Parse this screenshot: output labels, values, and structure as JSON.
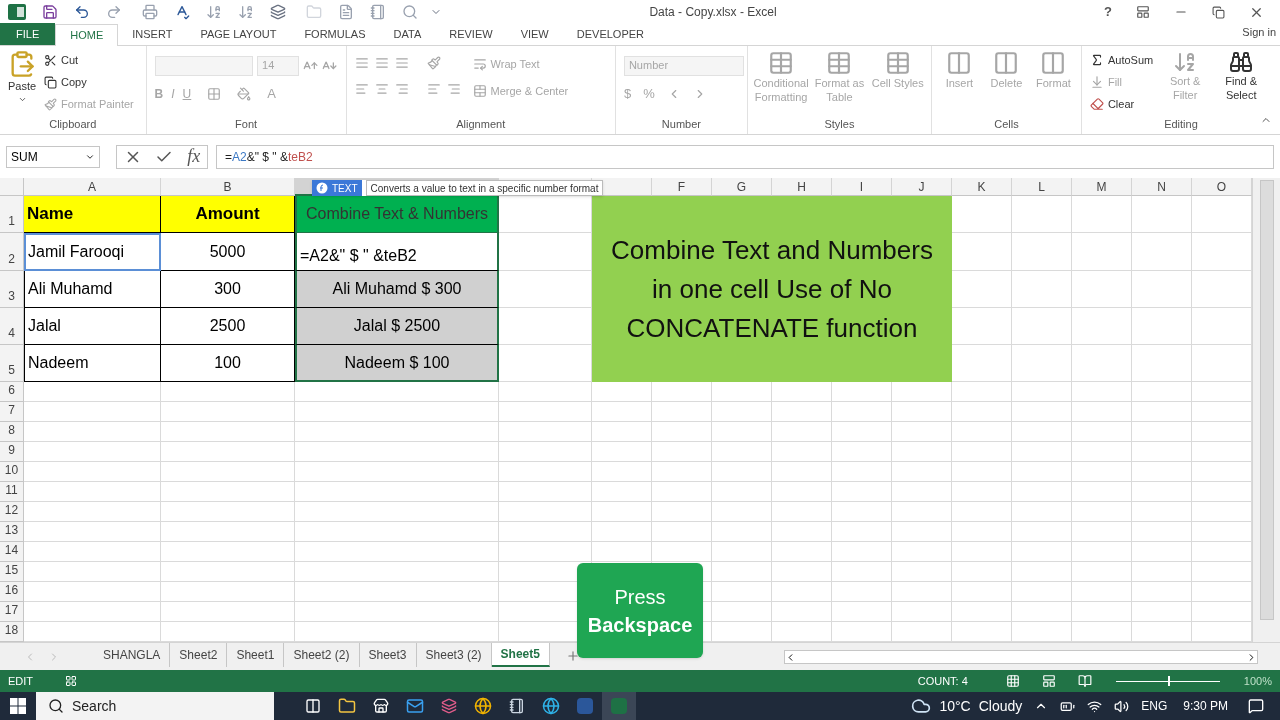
{
  "window": {
    "title": "Data - Copy.xlsx - Excel",
    "help": "?",
    "account": "Sign in"
  },
  "ribbon_tabs": [
    {
      "label": "FILE",
      "kind": "file",
      "selected": false
    },
    {
      "label": "HOME",
      "kind": "tab",
      "selected": true
    },
    {
      "label": "INSERT",
      "kind": "tab",
      "selected": false
    },
    {
      "label": "PAGE LAYOUT",
      "kind": "tab",
      "selected": false
    },
    {
      "label": "FORMULAS",
      "kind": "tab",
      "selected": false
    },
    {
      "label": "DATA",
      "kind": "tab",
      "selected": false
    },
    {
      "label": "REVIEW",
      "kind": "tab",
      "selected": false
    },
    {
      "label": "VIEW",
      "kind": "tab",
      "selected": false
    },
    {
      "label": "DEVELOPER",
      "kind": "tab",
      "selected": false
    }
  ],
  "ribbon_groups": [
    {
      "name": "Clipboard",
      "kind": "clipboard",
      "paste": "Paste",
      "commands": [
        {
          "label": "Cut",
          "disabled": false
        },
        {
          "label": "Copy",
          "disabled": false
        },
        {
          "label": "Format Painter",
          "disabled": true
        }
      ]
    },
    {
      "name": "Font",
      "kind": "font",
      "font_size": "14",
      "styles": [
        "B",
        "I",
        "U"
      ],
      "font_color": "A"
    },
    {
      "name": "Alignment",
      "kind": "alignment",
      "commands": [
        "Wrap Text",
        "Merge & Center"
      ]
    },
    {
      "name": "Number",
      "kind": "number",
      "format": "Number",
      "symbols": [
        "$",
        "%"
      ]
    },
    {
      "name": "Styles",
      "kind": "large",
      "commands": [
        "Conditional Formatting",
        "Format as Table",
        "Cell Styles"
      ]
    },
    {
      "name": "Cells",
      "kind": "large",
      "commands": [
        "Insert",
        "Delete",
        "Format"
      ]
    },
    {
      "name": "Editing",
      "kind": "editing",
      "commands": [
        {
          "label": "AutoSum",
          "disabled": false
        },
        {
          "label": "Fill",
          "disabled": true
        },
        {
          "label": "Clear",
          "disabled": false
        }
      ],
      "large": [
        {
          "label": "Sort & Filter",
          "disabled": true
        },
        {
          "label": "Find & Select",
          "disabled": false
        }
      ]
    }
  ],
  "formula_bar": {
    "name_box": "SUM",
    "fx": "fx",
    "formula": [
      {
        "text": "=",
        "color": "#222222"
      },
      {
        "text": "A2",
        "color": "#3b78c4"
      },
      {
        "text": "&\" $ \" &",
        "color": "#222222"
      },
      {
        "text": "teB2",
        "color": "#c0504d"
      }
    ]
  },
  "tooltip": {
    "function": "TEXT",
    "description": "Converts a value to text in a specific number format"
  },
  "columns": [
    {
      "header": "A",
      "selected": false
    },
    {
      "header": "B",
      "selected": false
    },
    {
      "selected": true
    },
    {
      "selected": false
    },
    {
      "selected": false
    },
    {
      "header": "F",
      "selected": false
    },
    {
      "header": "G",
      "selected": false
    },
    {
      "header": "H",
      "selected": false
    },
    {
      "header": "I",
      "selected": false
    },
    {
      "header": "J",
      "selected": false
    },
    {
      "header": "K",
      "selected": false
    },
    {
      "header": "L",
      "selected": false
    },
    {
      "header": "M",
      "selected": false
    },
    {
      "header": "N",
      "selected": false
    },
    {
      "header": "O",
      "selected": false
    }
  ],
  "rows": [
    {
      "header": "1",
      "cells": [
        {
          "text": "Name",
          "kind": "label",
          "selected": false
        },
        {
          "text": "Amount",
          "kind": "label",
          "selected": false
        },
        {
          "text": "Combine Text & Numbers",
          "kind": "title",
          "selected": false
        }
      ]
    },
    {
      "header": "2",
      "cells": [
        {
          "text": "Jamil Farooqi",
          "kind": "text",
          "selected": true
        },
        {
          "text": "5000",
          "kind": "number",
          "selected": false
        },
        {
          "text": "=A2&\" $ \" &teB2",
          "kind": "editing",
          "selected": false
        }
      ]
    },
    {
      "header": "3",
      "cells": [
        {
          "text": "Ali Muhamd",
          "kind": "text",
          "selected": false
        },
        {
          "text": "300",
          "kind": "number",
          "selected": false
        },
        {
          "text": "Ali Muhamd $ 300",
          "kind": "result",
          "selected": false
        }
      ]
    },
    {
      "header": "4",
      "cells": [
        {
          "text": "Jalal",
          "kind": "text",
          "selected": false
        },
        {
          "text": "2500",
          "kind": "number",
          "selected": false
        },
        {
          "text": "Jalal $ 2500",
          "kind": "result",
          "selected": false
        }
      ]
    },
    {
      "header": "5",
      "cells": [
        {
          "text": "Nadeem",
          "kind": "text",
          "selected": false
        },
        {
          "text": "100",
          "kind": "number",
          "selected": false
        },
        {
          "text": "Nadeem $ 100",
          "kind": "result",
          "selected": false
        }
      ]
    },
    {
      "header": "6"
    },
    {
      "header": "7"
    },
    {
      "header": "8"
    },
    {
      "header": "9"
    },
    {
      "header": "10"
    },
    {
      "header": "11"
    },
    {
      "header": "12"
    },
    {
      "header": "13"
    },
    {
      "header": "14"
    },
    {
      "header": "15"
    },
    {
      "header": "16"
    },
    {
      "header": "17"
    },
    {
      "header": "18"
    }
  ],
  "banner": {
    "lines": [
      "Combine Text and Numbers",
      "in one cell Use of No",
      "CONCATENATE function"
    ]
  },
  "key_hint": {
    "lines": [
      "Press",
      "**Backspace**"
    ]
  },
  "sheet_tabs": [
    {
      "label": "SHANGLA",
      "selected": false
    },
    {
      "label": "Sheet2",
      "selected": false
    },
    {
      "label": "Sheet1",
      "selected": false
    },
    {
      "label": "Sheet2 (2)",
      "selected": false
    },
    {
      "label": "Sheet3",
      "selected": false
    },
    {
      "label": "Sheet3 (2)",
      "selected": false
    },
    {
      "label": "Sheet5",
      "selected": true
    }
  ],
  "status_bar": {
    "mode": "EDIT",
    "count": "COUNT: 4",
    "zoom": {
      "label": "100%",
      "level": 0.5
    }
  },
  "taskbar": {
    "search": "Search",
    "temperature": "10°C",
    "weather": "Cloudy",
    "language": "ENG",
    "time": "9:30 PM"
  }
}
